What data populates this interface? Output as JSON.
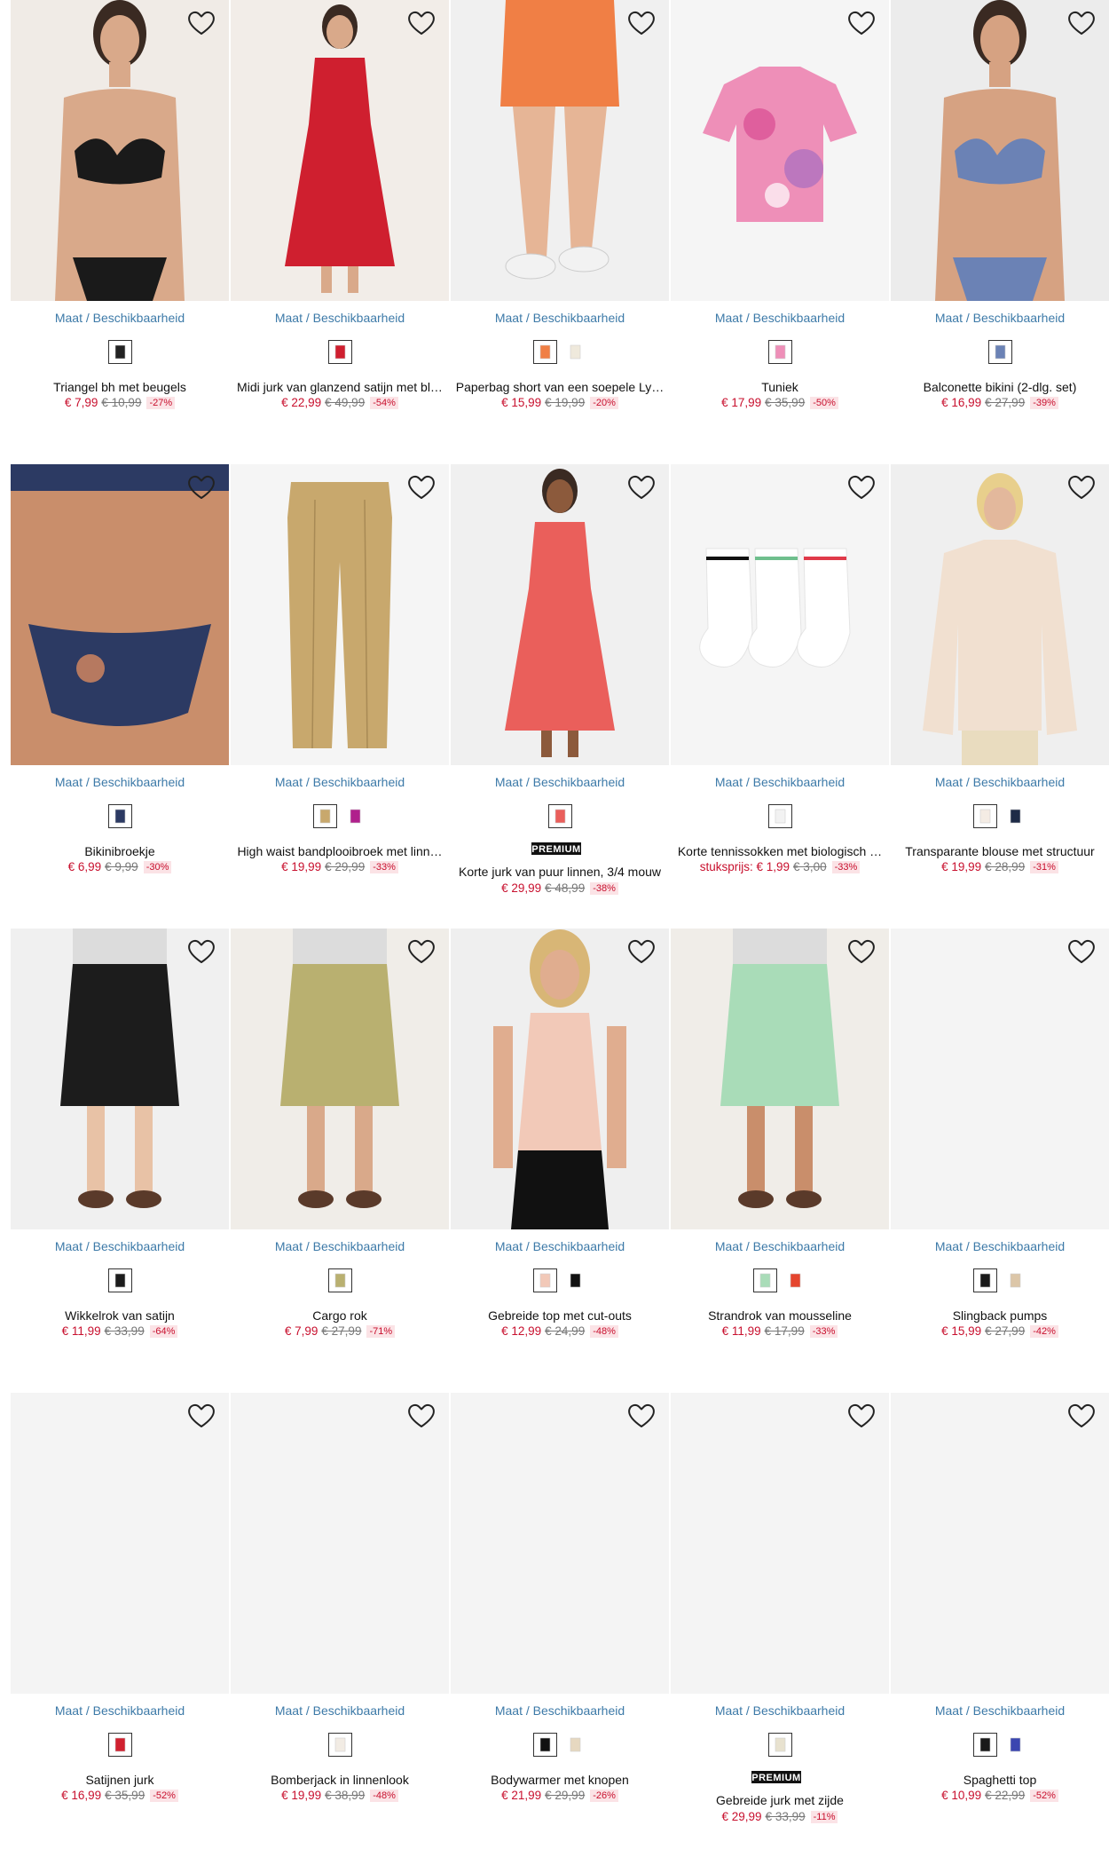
{
  "ui": {
    "availability_label": "Maat / Beschikbaarheid",
    "premium_label": "PREMIUM",
    "wishlist_icon": "heart-outline-icon"
  },
  "products": [
    {
      "title": "Triangel bh met beugels",
      "price": "€ 7,99",
      "old_price": "€ 10,99",
      "discount": "-27%",
      "premium": false,
      "photo": {
        "type": "model",
        "bg": "#f0ebe6",
        "top": "#1a1a1a",
        "bottom": "#1a1a1a",
        "skin": "#d9a98a"
      },
      "swatches": [
        "#222222"
      ]
    },
    {
      "title": "Midi jurk van glanzend satijn met bl…",
      "price": "€ 22,99",
      "old_price": "€ 49,99",
      "discount": "-54%",
      "premium": false,
      "photo": {
        "type": "dress",
        "bg": "#f2ede8",
        "color": "#cf1f2f",
        "skin": "#d9a98a"
      },
      "swatches": [
        "#cf1f2f"
      ]
    },
    {
      "title": "Paperbag short van een soepele Ly…",
      "price": "€ 15,99",
      "old_price": "€ 19,99",
      "discount": "-20%",
      "premium": false,
      "photo": {
        "type": "legs",
        "bg": "#f0f0f0",
        "color": "#f07f45",
        "skin": "#e6b596"
      },
      "swatches": [
        "#f07f45",
        "#efe9dc"
      ]
    },
    {
      "title": "Tuniek",
      "price": "€ 17,99",
      "old_price": "€ 35,99",
      "discount": "-50%",
      "premium": false,
      "photo": {
        "type": "flat-top",
        "bg": "#f5f5f5",
        "color": "#ee8fb8"
      },
      "swatches": [
        "#ee8fb8"
      ]
    },
    {
      "title": "Balconette bikini (2-dlg. set)",
      "price": "€ 16,99",
      "old_price": "€ 27,99",
      "discount": "-39%",
      "premium": false,
      "photo": {
        "type": "model",
        "bg": "#ececec",
        "top": "#6b82b5",
        "bottom": "#6b82b5",
        "skin": "#d6a282"
      },
      "swatches": [
        "#6b82b5"
      ]
    },
    {
      "title": "Bikinibroekje",
      "price": "€ 6,99",
      "old_price": "€ 9,99",
      "discount": "-30%",
      "premium": false,
      "photo": {
        "type": "torso",
        "bg": "#f0ebe6",
        "color": "#2c3a63",
        "skin": "#c98e6b"
      },
      "swatches": [
        "#2c3a63"
      ]
    },
    {
      "title": "High waist bandplooibroek met linn…",
      "price": "€ 19,99",
      "old_price": "€ 29,99",
      "discount": "-33%",
      "premium": false,
      "photo": {
        "type": "flat-pants",
        "bg": "#f5f5f5",
        "color": "#c8a86d"
      },
      "swatches": [
        "#c8a86d",
        "#b0208c"
      ]
    },
    {
      "title": "Korte jurk van puur linnen, 3/4 mouw",
      "price": "€ 29,99",
      "old_price": "€ 48,99",
      "discount": "-38%",
      "premium": true,
      "photo": {
        "type": "dress",
        "bg": "#f0f0f0",
        "color": "#ea5f5b",
        "skin": "#8c5a3c"
      },
      "swatches": [
        "#ea5f5b"
      ]
    },
    {
      "title": "Korte tennissokken met biologisch …",
      "unit": "stuksprijs:",
      "price": "€ 1,99",
      "old_price": "€ 3,00",
      "discount": "-33%",
      "premium": false,
      "photo": {
        "type": "socks",
        "bg": "#f5f5f5",
        "color": "#ffffff"
      },
      "swatches": [
        "#f2f2f2"
      ]
    },
    {
      "title": "Transparante blouse met structuur",
      "price": "€ 19,99",
      "old_price": "€ 28,99",
      "discount": "-31%",
      "premium": false,
      "photo": {
        "type": "blouse",
        "bg": "#efefef",
        "color": "#f1e0d0",
        "skin": "#e3b89c"
      },
      "swatches": [
        "#f4ece4",
        "#1e2b47"
      ]
    },
    {
      "title": "Wikkelrok van satijn",
      "price": "€ 11,99",
      "old_price": "€ 33,99",
      "discount": "-64%",
      "premium": false,
      "photo": {
        "type": "skirt",
        "bg": "#f0f0f0",
        "color": "#1c1c1c",
        "skin": "#e8c2a6"
      },
      "swatches": [
        "#1c1c1c"
      ]
    },
    {
      "title": "Cargo rok",
      "price": "€ 7,99",
      "old_price": "€ 27,99",
      "discount": "-71%",
      "premium": false,
      "photo": {
        "type": "skirt",
        "bg": "#f0ede8",
        "color": "#b9b070",
        "skin": "#d9a98a"
      },
      "swatches": [
        "#b9b070"
      ]
    },
    {
      "title": "Gebreide top met cut-outs",
      "price": "€ 12,99",
      "old_price": "€ 24,99",
      "discount": "-48%",
      "premium": false,
      "photo": {
        "type": "top-model",
        "bg": "#efefef",
        "color": "#f2c9b8",
        "skin": "#e0ad8f"
      },
      "swatches": [
        "#f2c9b8",
        "#111111"
      ]
    },
    {
      "title": "Strandrok van mousseline",
      "price": "€ 11,99",
      "old_price": "€ 17,99",
      "discount": "-33%",
      "premium": false,
      "photo": {
        "type": "skirt",
        "bg": "#f0ede8",
        "color": "#a9dcb8",
        "skin": "#c98e6b"
      },
      "swatches": [
        "#a9dcb8",
        "#e5452e"
      ]
    },
    {
      "title": "Slingback pumps",
      "price": "€ 15,99",
      "old_price": "€ 27,99",
      "discount": "-42%",
      "premium": false,
      "photo": {
        "type": "blank",
        "bg": "#f4f4f4"
      },
      "swatches": [
        "#1a1a1a",
        "#dcc6a8"
      ]
    },
    {
      "title": "Satijnen jurk",
      "price": "€ 16,99",
      "old_price": "€ 35,99",
      "discount": "-52%",
      "premium": false,
      "photo": {
        "type": "blank",
        "bg": "#f4f4f4"
      },
      "swatches": [
        "#d0202f"
      ]
    },
    {
      "title": "Bomberjack in linnenlook",
      "price": "€ 19,99",
      "old_price": "€ 38,99",
      "discount": "-48%",
      "premium": false,
      "photo": {
        "type": "blank",
        "bg": "#f4f4f4"
      },
      "swatches": [
        "#f2ece4"
      ]
    },
    {
      "title": "Bodywarmer met knopen",
      "price": "€ 21,99",
      "old_price": "€ 29,99",
      "discount": "-26%",
      "premium": false,
      "photo": {
        "type": "blank",
        "bg": "#f4f4f4"
      },
      "swatches": [
        "#111111",
        "#e6d8c0"
      ]
    },
    {
      "title": "Gebreide jurk met zijde",
      "price": "€ 29,99",
      "old_price": "€ 33,99",
      "discount": "-11%",
      "premium": true,
      "photo": {
        "type": "blank",
        "bg": "#f4f4f4"
      },
      "swatches": [
        "#e8e2cf"
      ]
    },
    {
      "title": "Spaghetti top",
      "price": "€ 10,99",
      "old_price": "€ 22,99",
      "discount": "-52%",
      "premium": false,
      "photo": {
        "type": "blank",
        "bg": "#f4f4f4"
      },
      "swatches": [
        "#1a1a1a",
        "#3b46b0"
      ]
    }
  ]
}
